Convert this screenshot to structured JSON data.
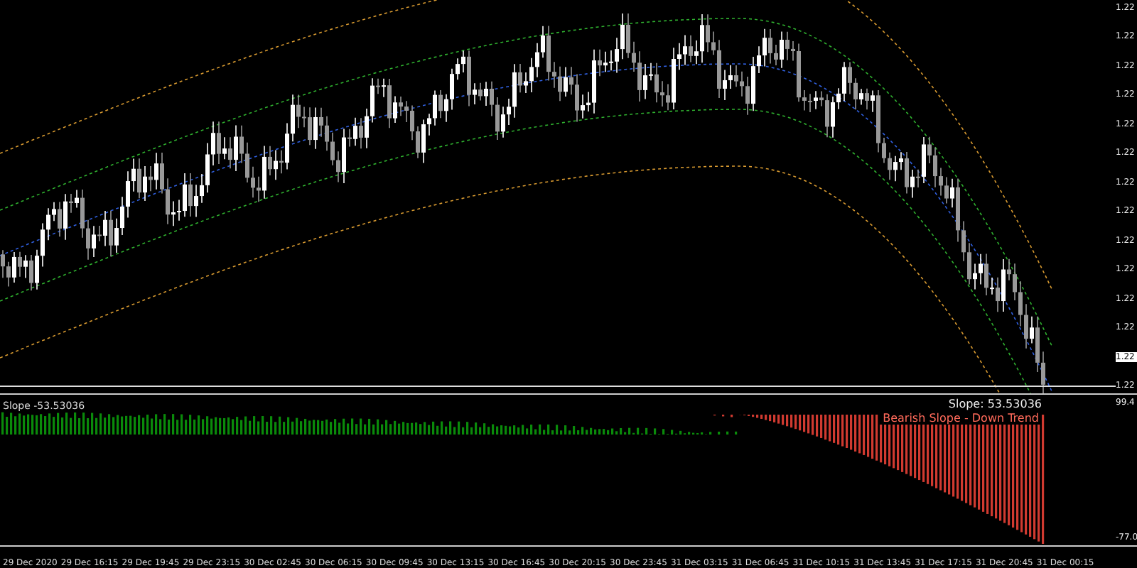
{
  "price_axis": {
    "labels": [
      "1.22",
      "1.22",
      "1.22",
      "1.22",
      "1.22",
      "1.22",
      "1.22",
      "1.22",
      "1.22",
      "1.22",
      "1.22",
      "1.22"
    ],
    "current_price": "1.22",
    "bottom_label": "1.22"
  },
  "indicator": {
    "title": "Slope -53.53036",
    "value_label": "Slope:  53.53036",
    "trend_label": "Bearish Slope - Down Trend",
    "axis_labels": [
      "99.4",
      "-77.0"
    ]
  },
  "time_axis": {
    "labels": [
      "29 Dec 2020",
      "29 Dec 16:15",
      "29 Dec 19:45",
      "29 Dec 23:15",
      "30 Dec 02:45",
      "30 Dec 06:15",
      "30 Dec 09:45",
      "30 Dec 13:15",
      "30 Dec 16:45",
      "30 Dec 20:15",
      "30 Dec 23:45",
      "31 Dec 03:15",
      "31 Dec 06:45",
      "31 Dec 10:15",
      "31 Dec 13:45",
      "31 Dec 17:15",
      "31 Dec 20:45",
      "31 Dec 00:15"
    ]
  }
}
